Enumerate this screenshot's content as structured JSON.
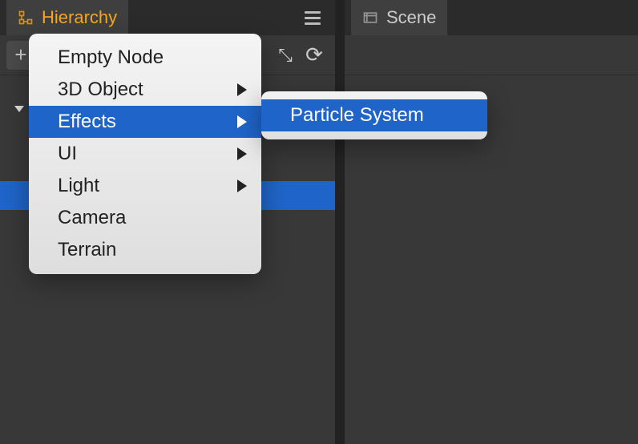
{
  "hierarchy": {
    "tab_label": "Hierarchy",
    "add_glyph": "+",
    "collapse_glyph": "⤡",
    "refresh_glyph": "⟳"
  },
  "scene": {
    "tab_label": "Scene"
  },
  "context_menu": {
    "items": [
      {
        "label": "Empty Node",
        "has_children": false
      },
      {
        "label": "3D Object",
        "has_children": true
      },
      {
        "label": "Effects",
        "has_children": true
      },
      {
        "label": "UI",
        "has_children": true
      },
      {
        "label": "Light",
        "has_children": true
      },
      {
        "label": "Camera",
        "has_children": false
      },
      {
        "label": "Terrain",
        "has_children": false
      }
    ],
    "highlighted": "Effects"
  },
  "submenu": {
    "items": [
      {
        "label": "Particle System"
      }
    ],
    "highlighted": "Particle System"
  }
}
